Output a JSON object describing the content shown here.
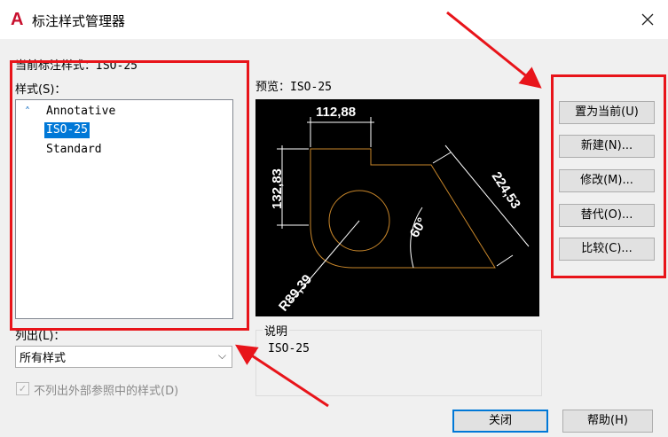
{
  "window": {
    "title": "标注样式管理器",
    "app_icon_letter": "A"
  },
  "current_style": {
    "label": "当前标注样式：",
    "value": "ISO-25"
  },
  "styles": {
    "label": "样式(S)：",
    "items": [
      {
        "label": "Annotative",
        "selected": false,
        "icon": "annotative-icon"
      },
      {
        "label": "ISO-25",
        "selected": true
      },
      {
        "label": "Standard",
        "selected": false
      }
    ]
  },
  "preview": {
    "label": "预览：",
    "value": "ISO-25",
    "dims": {
      "top": "112,88",
      "left": "132,83",
      "slant": "224,53",
      "angle": "60°",
      "radius": "R89,39"
    }
  },
  "list": {
    "label": "列出(L)：",
    "selected": "所有样式"
  },
  "exclude_xref": {
    "label": "不列出外部参照中的样式(D)",
    "checked": true,
    "disabled": true
  },
  "description": {
    "label": "说明",
    "text": "ISO-25"
  },
  "buttons": {
    "set_current": "置为当前(U)",
    "new": "新建(N)...",
    "modify": "修改(M)...",
    "override": "替代(O)...",
    "compare": "比较(C)...",
    "close": "关闭",
    "help": "帮助(H)"
  },
  "colors": {
    "annotation": "#e8141a",
    "selection": "#0078d7",
    "outline": "#c8862a"
  }
}
